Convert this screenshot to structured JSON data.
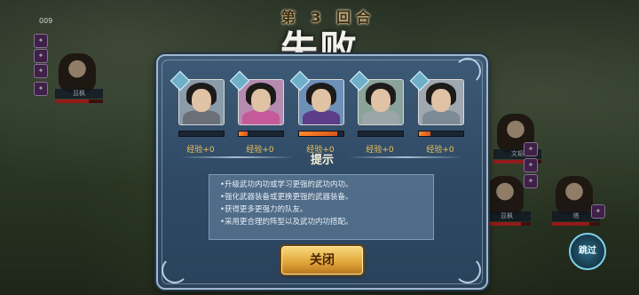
{
  "counter": "009",
  "round_label": "第 3 回合",
  "result_title": "失败",
  "heroes": [
    {
      "level_badge": "",
      "exp_label": "经验+0",
      "progress": 0.0
    },
    {
      "level_badge": "",
      "exp_label": "经验+0",
      "progress": 0.2
    },
    {
      "level_badge": "",
      "exp_label": "经验+0",
      "progress": 0.85
    },
    {
      "level_badge": "",
      "exp_label": "经验+0",
      "progress": 0.0
    },
    {
      "level_badge": "",
      "exp_label": "经验+0",
      "progress": 0.25
    }
  ],
  "tips_title": "提示",
  "tips": [
    "•升级武功内功或学习更强的武功内功。",
    "•强化武器装备或更换更强的武器装备。",
    "•获得更多更强力的队友。",
    "•采用更合理的阵型以及武功内功搭配。"
  ],
  "close_label": "关闭",
  "skip_label": "跳过",
  "left_units": [
    {
      "name": "显枫"
    }
  ],
  "right_units": [
    {
      "name": "文韬"
    },
    {
      "name": "显枫"
    },
    {
      "name": "塔"
    }
  ],
  "colors": {
    "exp_text": "#f0c25a",
    "bar_fill": "#e0701f",
    "panel": "#34506c"
  }
}
